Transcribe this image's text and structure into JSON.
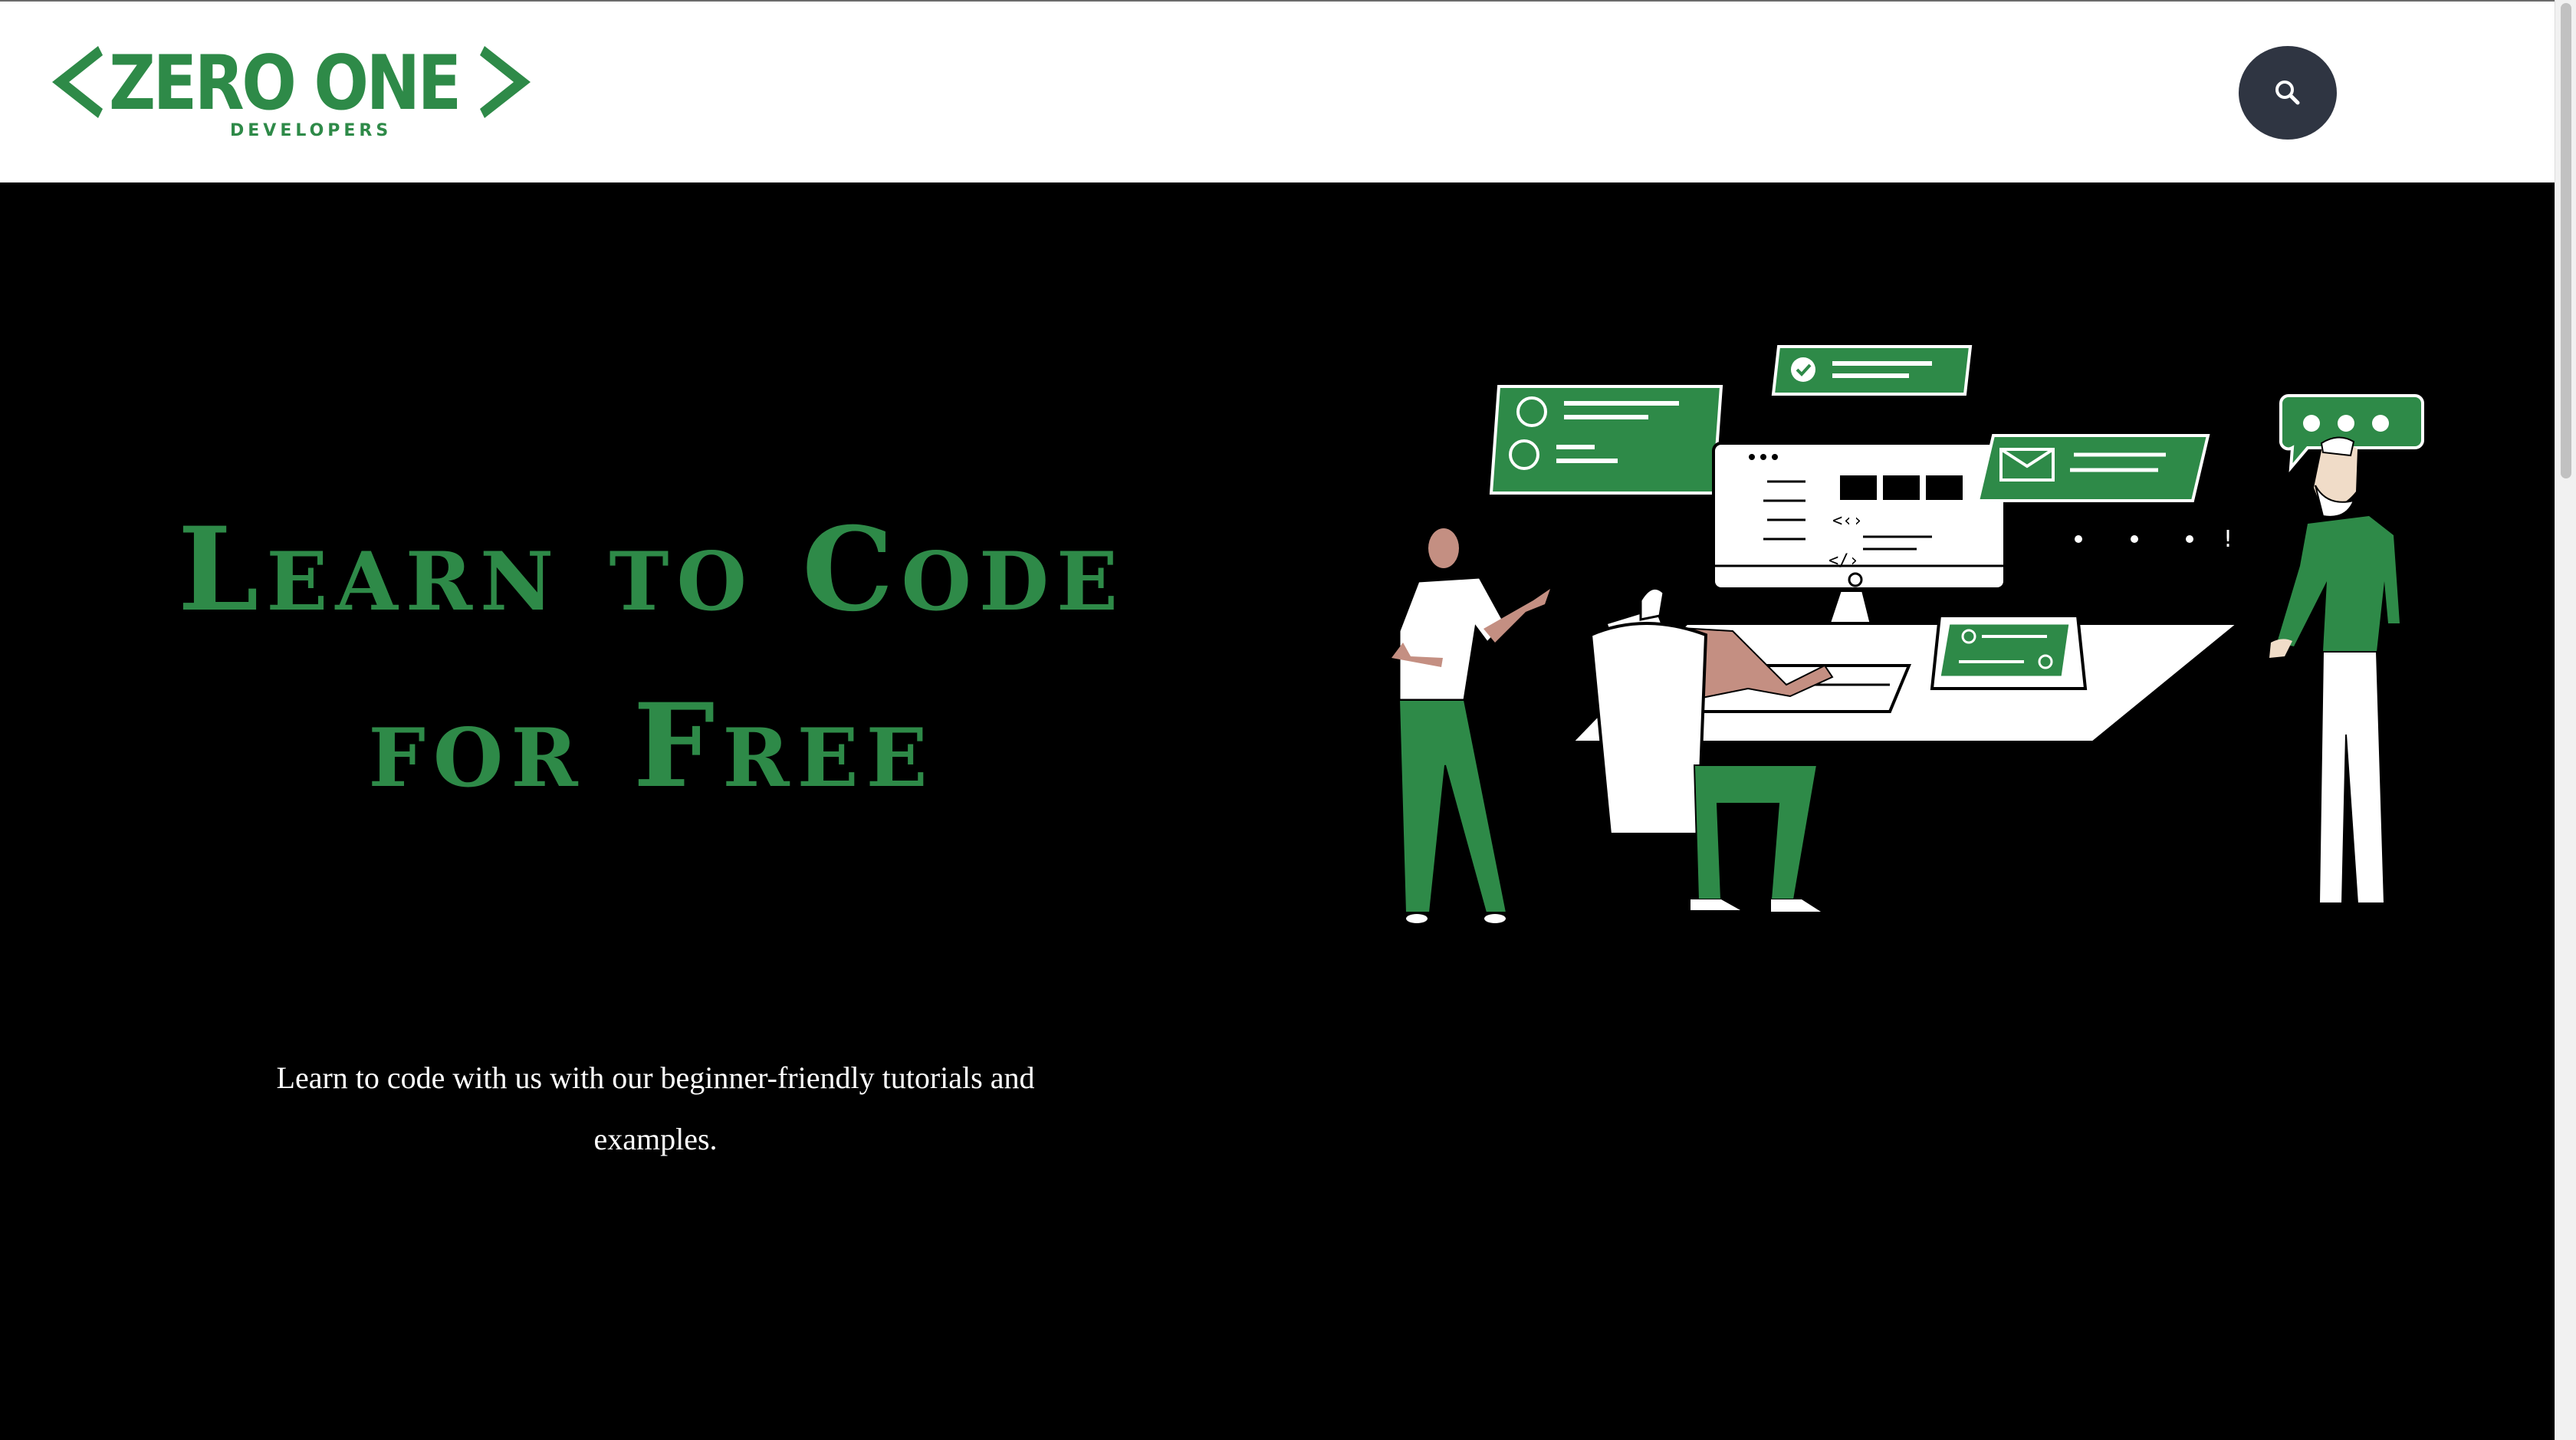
{
  "header": {
    "logo": {
      "name": "ZERO ONE",
      "tagline": "DEVELOPERS"
    },
    "search_button_icon": "search-icon"
  },
  "hero": {
    "title_line1": "Learn to Code",
    "title_line2": "for Free",
    "subtitle_line1": "Learn to code with us with our beginner-friendly tutorials and",
    "subtitle_line2": "examples."
  },
  "colors": {
    "brand_green": "#2e8a48",
    "hero_bg": "#000000",
    "search_button": "#2f3542",
    "skin": "#c48f82"
  }
}
